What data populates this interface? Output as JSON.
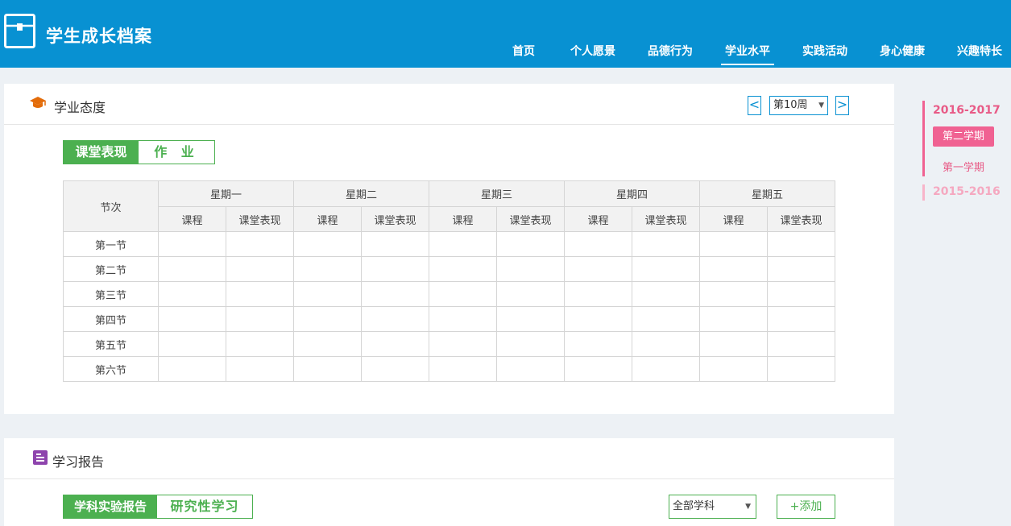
{
  "app": {
    "title": "学生成长档案"
  },
  "nav": [
    {
      "label": "首页"
    },
    {
      "label": "个人愿景"
    },
    {
      "label": "品德行为"
    },
    {
      "label": "学业水平",
      "active": true
    },
    {
      "label": "实践活动"
    },
    {
      "label": "身心健康"
    },
    {
      "label": "兴趣特长"
    }
  ],
  "attitude": {
    "title": "学业态度",
    "week": {
      "prev": "<",
      "current": "第10周",
      "next": ">"
    },
    "tabs": [
      {
        "label": "课堂表现",
        "active": true
      },
      {
        "label": "作 业"
      }
    ],
    "table": {
      "corner": "节次",
      "days": [
        "星期一",
        "星期二",
        "星期三",
        "星期四",
        "星期五"
      ],
      "sub": {
        "course": "课程",
        "performance": "课堂表现"
      },
      "lessons": [
        "第一节",
        "第二节",
        "第三节",
        "第四节",
        "第五节",
        "第六节"
      ]
    }
  },
  "report": {
    "title": "学习报告",
    "tabs": [
      {
        "label": "学科实验报告",
        "active": true
      },
      {
        "label": "研究性学习"
      }
    ],
    "subject_select": "全部学科",
    "add_label": "+添加"
  },
  "timeline": {
    "year1": "2016-2017",
    "term_active": "第二学期",
    "term": "第一学期",
    "year2": "2015-2016"
  },
  "colors": {
    "header": "#0891d2",
    "green": "#4cb050",
    "pink": "#f06292",
    "cap_icon": "#e36c0a",
    "report_icon": "#8e44ad"
  }
}
